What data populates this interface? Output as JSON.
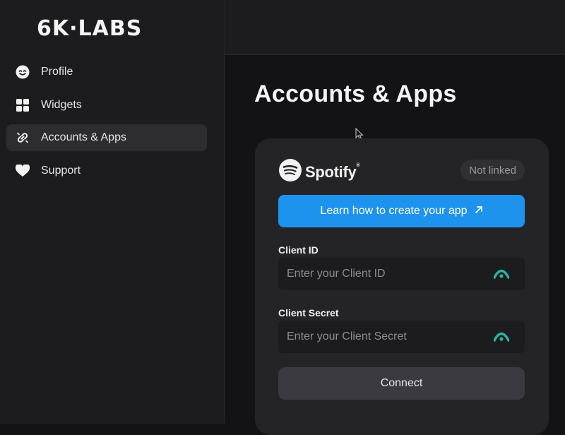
{
  "brand": {
    "logo_text": "6K·LABS"
  },
  "sidebar": {
    "items": [
      {
        "label": "Profile",
        "icon": "smiley-face-icon",
        "active": false
      },
      {
        "label": "Widgets",
        "icon": "grid-icon",
        "active": false
      },
      {
        "label": "Accounts & Apps",
        "icon": "link-icon",
        "active": true
      },
      {
        "label": "Support",
        "icon": "heart-icon",
        "active": false
      }
    ]
  },
  "main": {
    "title": "Accounts & Apps",
    "card": {
      "service_name": "Spotify",
      "service_trademark": "®",
      "service_icon": "spotify-icon",
      "status_badge": "Not linked",
      "learn_button": "Learn how to create your app",
      "client_id": {
        "label": "Client ID",
        "placeholder": "Enter your Client ID",
        "value": ""
      },
      "client_secret": {
        "label": "Client Secret",
        "placeholder": "Enter your Client Secret",
        "value": ""
      },
      "connect_button": "Connect"
    }
  },
  "colors": {
    "accent": "#1e93ee",
    "background": "#131315",
    "sidebar": "#1c1c1f",
    "card": "#242427",
    "eye_icon": "#2bb3a3"
  }
}
